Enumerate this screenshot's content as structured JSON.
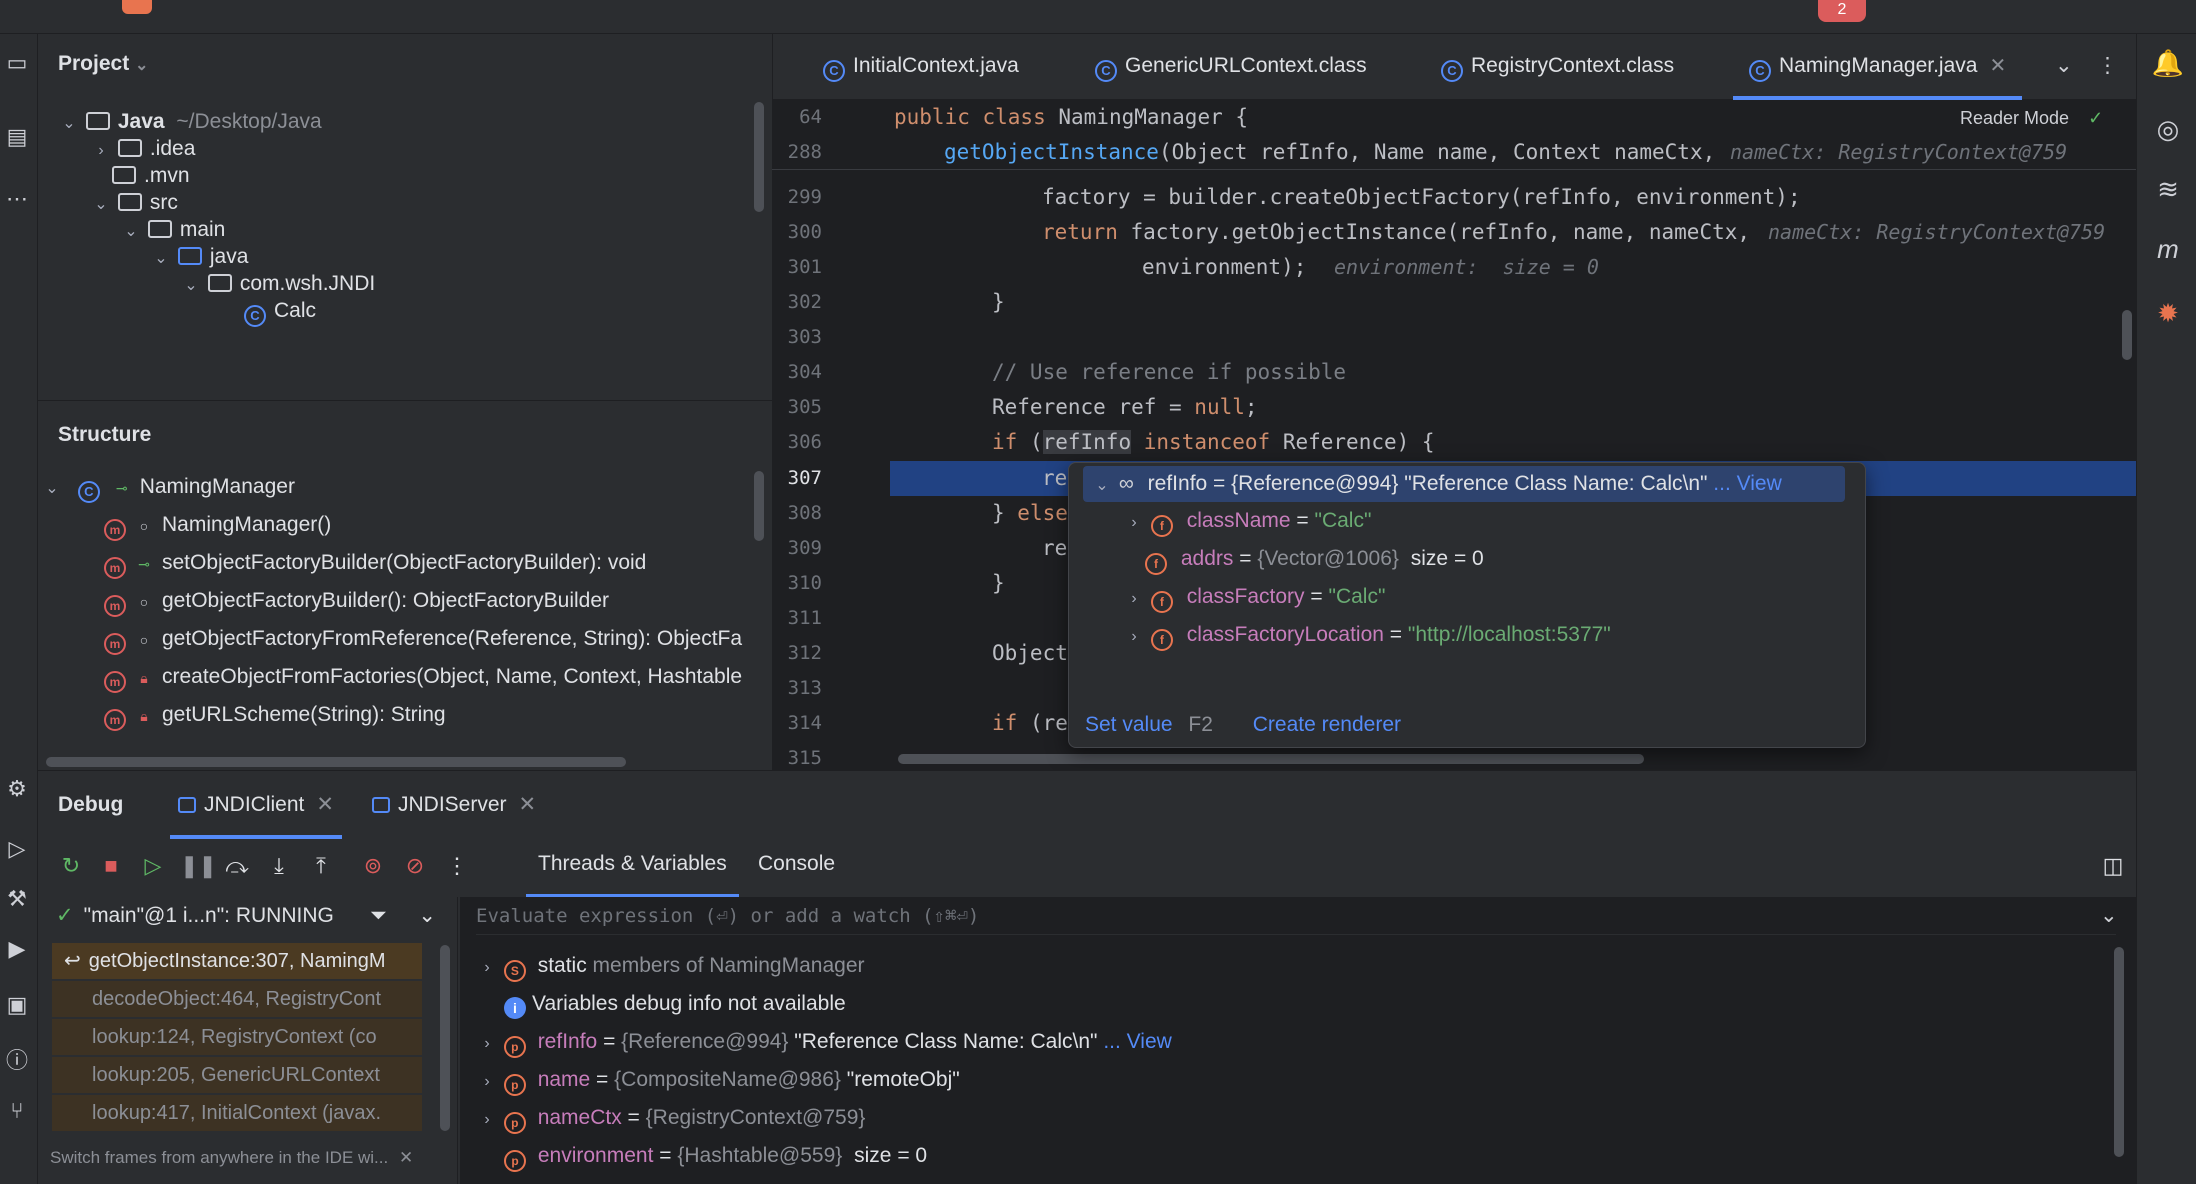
{
  "colors": {
    "accent": "#548af7",
    "string": "#6aab73",
    "keyword": "#cf8e6d",
    "selection": "#214283"
  },
  "topbar": {
    "badge": "2"
  },
  "project": {
    "title": "Project",
    "root_name": "Java",
    "root_path": "~/Desktop/Java",
    "items": [
      ".idea",
      ".mvn",
      "src",
      "main",
      "java",
      "com.wsh.JNDI",
      "Calc"
    ]
  },
  "structure": {
    "title": "Structure",
    "class_name": "NamingManager",
    "members": [
      "NamingManager()",
      "setObjectFactoryBuilder(ObjectFactoryBuilder): void",
      "getObjectFactoryBuilder(): ObjectFactoryBuilder",
      "getObjectFactoryFromReference(Reference, String): ObjectFa",
      "createObjectFromFactories(Object, Name, Context, Hashtable",
      "getURLScheme(String): String"
    ]
  },
  "tabs": [
    {
      "label": "InitialContext.java"
    },
    {
      "label": "GenericURLContext.class"
    },
    {
      "label": "RegistryContext.class"
    },
    {
      "label": "NamingManager.java"
    }
  ],
  "editor": {
    "reader_mode": "Reader Mode",
    "sticky": [
      {
        "ln": "64",
        "code": "public class NamingManager {"
      },
      {
        "ln": "288",
        "code": "getObjectInstance(Object refInfo, Name name, Context nameCtx,",
        "hint": "nameCtx: RegistryContext@759"
      }
    ],
    "lines": [
      {
        "ln": "299",
        "code": "factory = builder.createObjectFactory(refInfo, environment);"
      },
      {
        "ln": "300",
        "code": "return factory.getObjectInstance(refInfo, name, nameCtx,",
        "hint": "nameCtx: RegistryContext@759"
      },
      {
        "ln": "301",
        "code": "environment);",
        "hint": "environment:  size = 0"
      },
      {
        "ln": "302",
        "code": "}"
      },
      {
        "ln": "303",
        "code": ""
      },
      {
        "ln": "304",
        "code": "// Use reference if possible"
      },
      {
        "ln": "305",
        "code": "Reference ref = null;"
      },
      {
        "ln": "306",
        "code": "if (refInfo instanceof Reference) {"
      },
      {
        "ln": "307",
        "code": "re"
      },
      {
        "ln": "308",
        "code": "} else"
      },
      {
        "ln": "309",
        "code": "re"
      },
      {
        "ln": "310",
        "code": "}"
      },
      {
        "ln": "311",
        "code": ""
      },
      {
        "ln": "312",
        "code": "Object"
      },
      {
        "ln": "313",
        "code": ""
      },
      {
        "ln": "314",
        "code": "if (re"
      },
      {
        "ln": "315",
        "code": ""
      }
    ]
  },
  "popup": {
    "root": {
      "name": "refInfo",
      "value": "{Reference@994} \"Reference Class Name: Calc\\n\"",
      "view": "... View"
    },
    "fields": [
      {
        "name": "className",
        "value": "\"Calc\"",
        "extra": ""
      },
      {
        "name": "addrs",
        "value": "{Vector@1006}",
        "extra": "size = 0"
      },
      {
        "name": "classFactory",
        "value": "\"Calc\"",
        "extra": ""
      },
      {
        "name": "classFactoryLocation",
        "value": "\"http://localhost:5377\"",
        "extra": ""
      }
    ],
    "set_value": "Set value",
    "set_value_key": "F2",
    "create_renderer": "Create renderer"
  },
  "debug": {
    "title": "Debug",
    "sessions": [
      "JNDIClient",
      "JNDIServer"
    ],
    "tabs": [
      "Threads & Variables",
      "Console"
    ],
    "thread": "\"main\"@1 i...n\": RUNNING",
    "eval_placeholder": "Evaluate expression (⏎) or add a watch (⇧⌘⏎)",
    "frames": [
      {
        "label": "getObjectInstance:307, NamingM"
      },
      {
        "label": "decodeObject:464, RegistryCont"
      },
      {
        "label": "lookup:124, RegistryContext (co"
      },
      {
        "label": "lookup:205, GenericURLContext"
      },
      {
        "label": "lookup:417, InitialContext (javax."
      }
    ],
    "hint": "Switch frames from anywhere in the IDE wi...",
    "vars": {
      "static_label": "static",
      "static_rest": "members of NamingManager",
      "info": "Variables debug info not available",
      "refInfo_name": "refInfo",
      "refInfo_ref": "{Reference@994}",
      "refInfo_val": "\"Reference Class Name: Calc\\n\"",
      "refInfo_view": "... View",
      "name_name": "name",
      "name_ref": "{CompositeName@986}",
      "name_val": "\"remoteObj\"",
      "nameCtx_name": "nameCtx",
      "nameCtx_ref": "{RegistryContext@759}",
      "env_name": "environment",
      "env_ref": "{Hashtable@559}",
      "env_size": "size = 0"
    }
  }
}
